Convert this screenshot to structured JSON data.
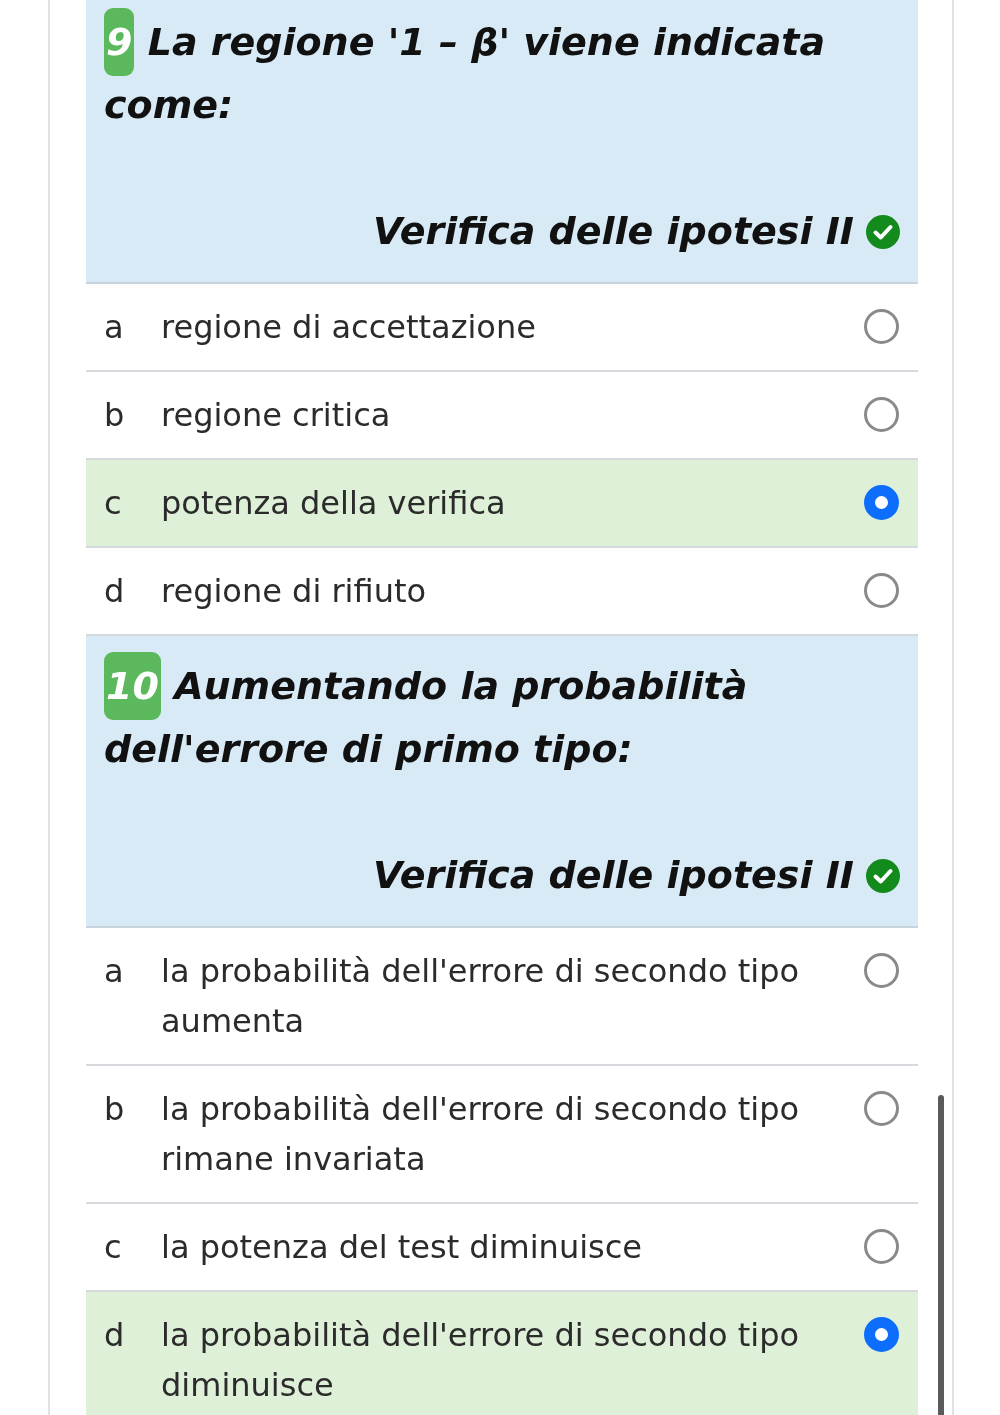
{
  "questions": [
    {
      "number": "9",
      "text": "La regione '1 – β' viene indicata come:",
      "tag": "Verifica delle ipotesi II",
      "options": [
        {
          "letter": "a",
          "text": "regione di accettazione",
          "selected": false
        },
        {
          "letter": "b",
          "text": "regione critica",
          "selected": false
        },
        {
          "letter": "c",
          "text": "potenza della verifica",
          "selected": true
        },
        {
          "letter": "d",
          "text": "regione di rifiuto",
          "selected": false
        }
      ]
    },
    {
      "number": "10",
      "text": "Aumentando la probabilità dell'errore di primo tipo:",
      "tag": "Verifica delle ipotesi II",
      "options": [
        {
          "letter": "a",
          "text": "la probabilità dell'errore di secondo tipo aumenta",
          "selected": false
        },
        {
          "letter": "b",
          "text": "la probabilità dell'errore di secondo tipo rimane invariata",
          "selected": false
        },
        {
          "letter": "c",
          "text": "la potenza del test diminuisce",
          "selected": false
        },
        {
          "letter": "d",
          "text": "la probabilità dell'errore di secondo tipo diminuisce",
          "selected": true
        }
      ]
    }
  ]
}
